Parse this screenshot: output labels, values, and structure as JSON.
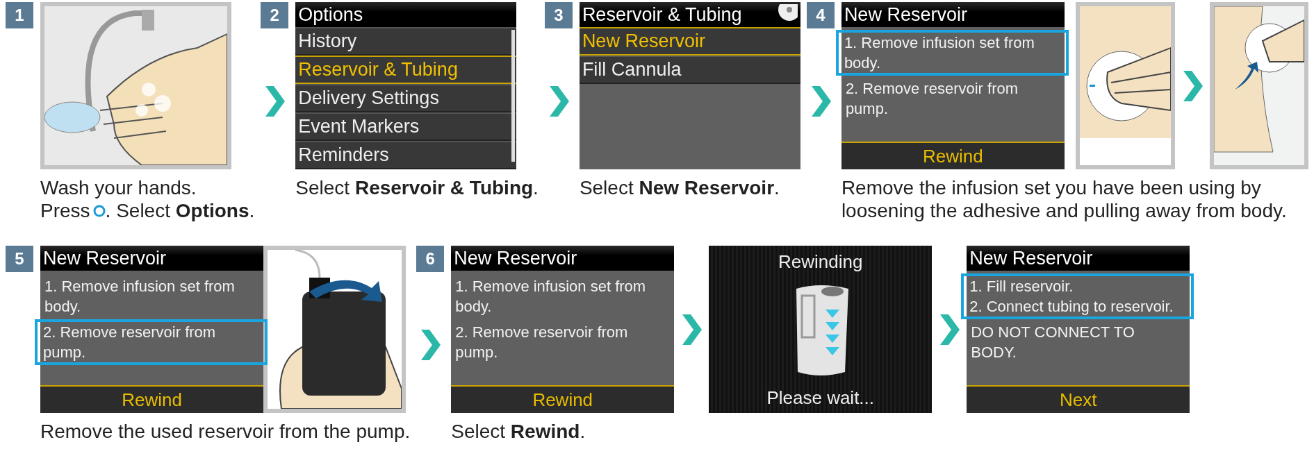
{
  "rows": [
    {
      "steps": [
        {
          "number": "1",
          "items": [
            {
              "kind": "hands_illustration"
            }
          ],
          "caption": [
            {
              "text": "Wash your hands."
            },
            {
              "kind": "button_line",
              "text": "Press",
              "after": ". Select **Options**."
            }
          ]
        },
        {
          "number": "2",
          "items": [
            {
              "kind": "menu_screen",
              "title": "Options",
              "scrollbar": true,
              "rows": [
                {
                  "label": "History",
                  "selected": false
                },
                {
                  "label": "Reservoir & Tubing",
                  "selected": true
                },
                {
                  "label": "Delivery Settings",
                  "selected": false
                },
                {
                  "label": "Event Markers",
                  "selected": false
                },
                {
                  "label": "Reminders",
                  "selected": false
                }
              ]
            }
          ],
          "caption": [
            {
              "text": "Select **Reservoir & Tubing**."
            }
          ]
        },
        {
          "number": "3",
          "items": [
            {
              "kind": "menu_screen_with_icon",
              "title": "Reservoir & Tubing",
              "rows": [
                {
                  "label": "New Reservoir",
                  "selected": true
                },
                {
                  "label": "Fill Cannula",
                  "selected": false
                }
              ]
            }
          ],
          "caption": [
            {
              "text": "Select **New Reservoir**."
            }
          ]
        },
        {
          "number": "4",
          "items": [
            {
              "kind": "message_screen",
              "title": "New Reservoir",
              "entries": [
                {
                  "lines": [
                    "1. Remove infusion set from",
                    "body."
                  ],
                  "highlighted": true
                },
                {
                  "lines": [
                    "2. Remove reservoir from",
                    "pump."
                  ],
                  "highlighted": false
                }
              ],
              "softkey": "Rewind"
            },
            {
              "kind": "patch_illustration"
            },
            {
              "kind": "arrow"
            },
            {
              "kind": "patch_lift_illustration"
            }
          ],
          "caption": [
            {
              "text": "Remove the infusion set you have been using by"
            },
            {
              "text": "loosening the adhesive and pulling away from body."
            }
          ]
        }
      ]
    },
    {
      "steps": [
        {
          "number": "5",
          "items": [
            {
              "kind": "message_screen",
              "title": "New Reservoir",
              "entries": [
                {
                  "lines": [
                    "1. Remove infusion set from",
                    "body."
                  ],
                  "highlighted": false
                },
                {
                  "lines": [
                    "2. Remove reservoir from",
                    "pump."
                  ],
                  "highlighted": true
                }
              ],
              "softkey": "Rewind"
            },
            {
              "kind": "pump_illustration"
            }
          ],
          "caption": [
            {
              "text": "Remove the used reservoir from the pump."
            }
          ]
        },
        {
          "number": "6",
          "items": [
            {
              "kind": "message_screen",
              "title": "New Reservoir",
              "entries": [
                {
                  "lines": [
                    "1. Remove infusion set from",
                    "body."
                  ],
                  "highlighted": false
                },
                {
                  "lines": [
                    "2. Remove reservoir from",
                    "pump."
                  ],
                  "highlighted": false
                }
              ],
              "softkey": "Rewind"
            },
            {
              "kind": "arrow"
            },
            {
              "kind": "status_screen",
              "title": "Rewinding",
              "footer": "Please wait..."
            },
            {
              "kind": "arrow"
            },
            {
              "kind": "message_screen",
              "title": "New Reservoir",
              "entries": [
                {
                  "lines": [
                    "1. Fill reservoir.",
                    "2. Connect tubing to reservoir."
                  ],
                  "highlighted": true
                },
                {
                  "lines": [
                    "DO NOT CONNECT TO",
                    "BODY."
                  ],
                  "highlighted": false
                }
              ],
              "softkey": "Next"
            }
          ],
          "caption": [
            {
              "text": "Select **Rewind**."
            }
          ]
        }
      ]
    }
  ]
}
